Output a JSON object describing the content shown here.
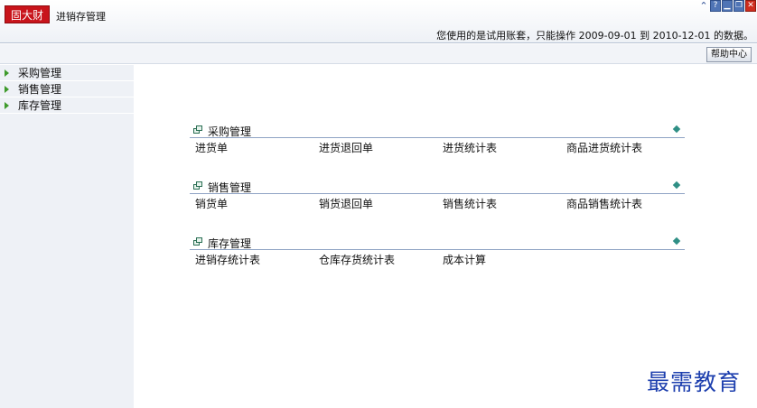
{
  "header": {
    "logo_text": "固大财",
    "module_title": "进销存管理",
    "trial_notice": "您使用的是试用账套，只能操作 2009-09-01 到 2010-12-01 的数据。",
    "window_buttons": [
      {
        "name": "collapse-up-icon",
        "glyph": "⌃"
      },
      {
        "name": "help-icon",
        "glyph": "?"
      },
      {
        "name": "minimize-icon",
        "glyph": "▁"
      },
      {
        "name": "restore-icon",
        "glyph": "❐"
      },
      {
        "name": "close-icon",
        "glyph": "✕"
      }
    ]
  },
  "help_button": "帮助中心",
  "sidebar": {
    "items": [
      {
        "label": "采购管理"
      },
      {
        "label": "销售管理"
      },
      {
        "label": "库存管理"
      }
    ]
  },
  "sections": [
    {
      "title": "采购管理",
      "links": [
        "进货单",
        "进货退回单",
        "进货统计表",
        "商品进货统计表"
      ]
    },
    {
      "title": "销售管理",
      "links": [
        "销货单",
        "销货退回单",
        "销售统计表",
        "商品销售统计表"
      ]
    },
    {
      "title": "库存管理",
      "links": [
        "进销存统计表",
        "仓库存货统计表",
        "成本计算"
      ]
    }
  ],
  "watermark": "最需教育",
  "colors": {
    "logo_bg": "#c8141b",
    "sidebar_bg": "#eef1f6",
    "arrow": "#3d9a2b",
    "expand_icon": "#2f8f85",
    "section_rule": "#8fa3c4",
    "watermark": "#1d3fae"
  }
}
